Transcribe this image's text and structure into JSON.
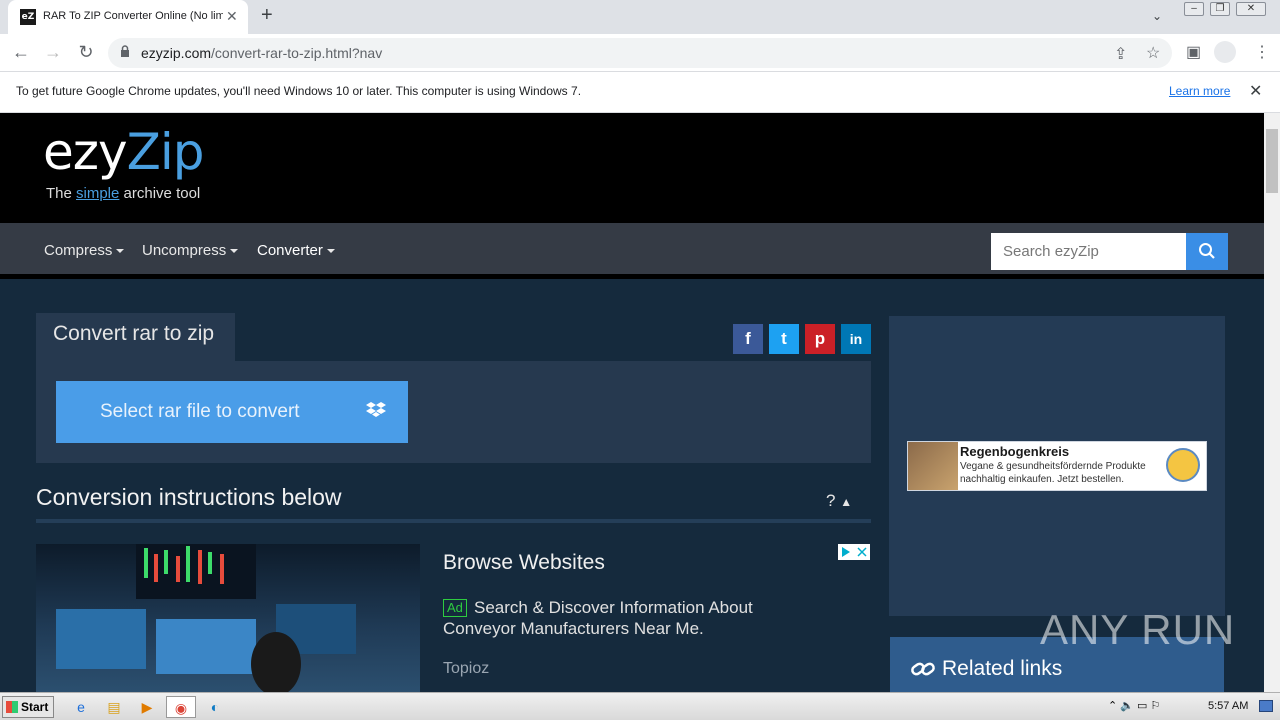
{
  "browser": {
    "tab_title": "RAR To ZIP Converter Online (No limit",
    "favicon_text": "eZ",
    "url_domain": "ezyzip.com",
    "url_path": "/convert-rar-to-zip.html?nav"
  },
  "infobar": {
    "message": "To get future Google Chrome updates, you'll need Windows 10 or later. This computer is using Windows 7.",
    "link": "Learn more"
  },
  "site": {
    "logo_ezy": "ezy",
    "logo_zip": "Zip",
    "tagline_pre": "The ",
    "tagline_mid": "simple",
    "tagline_post": " archive tool",
    "nav": [
      "Compress",
      "Uncompress",
      "Converter"
    ],
    "search_placeholder": "Search ezyZip"
  },
  "main": {
    "convert_title": "Convert rar to zip",
    "select_button": "Select rar file to convert",
    "instructions_title": "Conversion instructions below",
    "instructions_toggle": "?",
    "social": [
      {
        "name": "facebook",
        "glyph": "f",
        "color": "#3b5998"
      },
      {
        "name": "twitter",
        "glyph": "t",
        "color": "#1da1f2"
      },
      {
        "name": "pinterest",
        "glyph": "p",
        "color": "#cb2027"
      },
      {
        "name": "linkedin",
        "glyph": "in",
        "color": "#0077b5"
      }
    ]
  },
  "ad": {
    "title": "Browse Websites",
    "badge": "Ad",
    "description": "Search & Discover Information About Conveyor Manufacturers Near Me.",
    "source": "Topioz"
  },
  "sidebar": {
    "ad_title": "Regenbogenkreis",
    "ad_text": "Vegane & gesundheitsfördernde Produkte nachhaltig einkaufen. Jetzt bestellen.",
    "related_links": "Related links"
  },
  "watermark": "ANY RUN",
  "taskbar": {
    "start": "Start",
    "time": "5:57 AM"
  }
}
